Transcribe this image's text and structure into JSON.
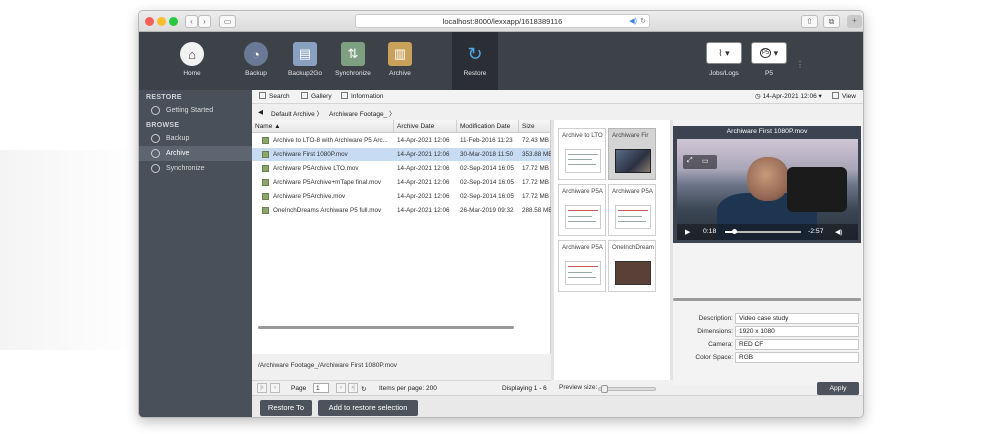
{
  "browser": {
    "url": "localhost:8000/lexxapp/1618389116",
    "back": "‹",
    "forward": "›"
  },
  "toolbar": {
    "home": "Home",
    "backup": "Backup",
    "backup2go": "Backup2Go",
    "synchronize": "Synchronize",
    "archive": "Archive",
    "restore": "Restore",
    "jobs": "Jobs/Logs",
    "p5": "P5",
    "p5_badge": "P5"
  },
  "sidebar": {
    "restore_head": "RESTORE",
    "getting_started": "Getting Started",
    "browse_head": "BROWSE",
    "items": [
      {
        "label": "Backup"
      },
      {
        "label": "Archive"
      },
      {
        "label": "Synchronize"
      }
    ]
  },
  "subbar": {
    "search": "Search",
    "gallery": "Gallery",
    "information": "Information",
    "datetime": "14-Apr-2021 12:06 ▾",
    "view": "View"
  },
  "breadcrumb": {
    "arrow": "◀",
    "items": [
      "Default Archive 〉",
      "Archiware Footage_ 〉"
    ]
  },
  "table": {
    "columns": [
      "Name ▲",
      "Archive Date",
      "Modification Date",
      "Size"
    ],
    "rows": [
      {
        "name": "Archive to LTO-8 with Archiware P5 Arc...",
        "archive_date": "14-Apr-2021 12:06",
        "mod_date": "11-Feb-2016 11:23",
        "size": "72.43 MB"
      },
      {
        "name": "Archiware First 1080P.mov",
        "archive_date": "14-Apr-2021 12:06",
        "mod_date": "30-Mar-2018 11:50",
        "size": "353.88 MB"
      },
      {
        "name": "Archiware P5Archive LTO.mov",
        "archive_date": "14-Apr-2021 12:06",
        "mod_date": "02-Sep-2014 16:05",
        "size": "17.72 MB"
      },
      {
        "name": "Archiware P5Archive+mTape final.mov",
        "archive_date": "14-Apr-2021 12:06",
        "mod_date": "02-Sep-2014 16:05",
        "size": "17.72 MB"
      },
      {
        "name": "Archiware P5Archive.mov",
        "archive_date": "14-Apr-2021 12:06",
        "mod_date": "02-Sep-2014 16:05",
        "size": "17.72 MB"
      },
      {
        "name": "OneInchDreams Archiware P5 full.mov",
        "archive_date": "14-Apr-2021 12:06",
        "mod_date": "26-Mar-2019 09:32",
        "size": "288.58 MB"
      }
    ]
  },
  "path": "/Archiware Footage_/Archiware First 1080P.mov",
  "pager": {
    "page_label": "Page",
    "page_value": "1",
    "of_label": "",
    "items_per_page": "Items per page: 200",
    "displaying": "Displaying 1 - 6"
  },
  "gallery": [
    {
      "label": "Archive to LTO"
    },
    {
      "label": "Archiware Fir"
    },
    {
      "label": "Archiware P5A"
    },
    {
      "label": "Archiware P5A"
    },
    {
      "label": "Archiware P5A"
    },
    {
      "label": "OneInchDream"
    }
  ],
  "preview_size_label": "Preview size:",
  "preview_size_level": 0.1,
  "video": {
    "title": "Archiware First 1080P.mov",
    "elapsed": "0:18",
    "remaining": "-2:57",
    "progress": 0.12
  },
  "metadata": {
    "description_label": "Description:",
    "description": "Video case study",
    "dimensions_label": "Dimensions:",
    "dimensions": "1920 x 1080",
    "camera_label": "Camera:",
    "camera": "RED CF",
    "colorspace_label": "Color Space:",
    "colorspace": "RGB",
    "apply": "Apply"
  },
  "buttons": {
    "restore_to": "Restore To",
    "add_to_restore": "Add to restore selection"
  }
}
